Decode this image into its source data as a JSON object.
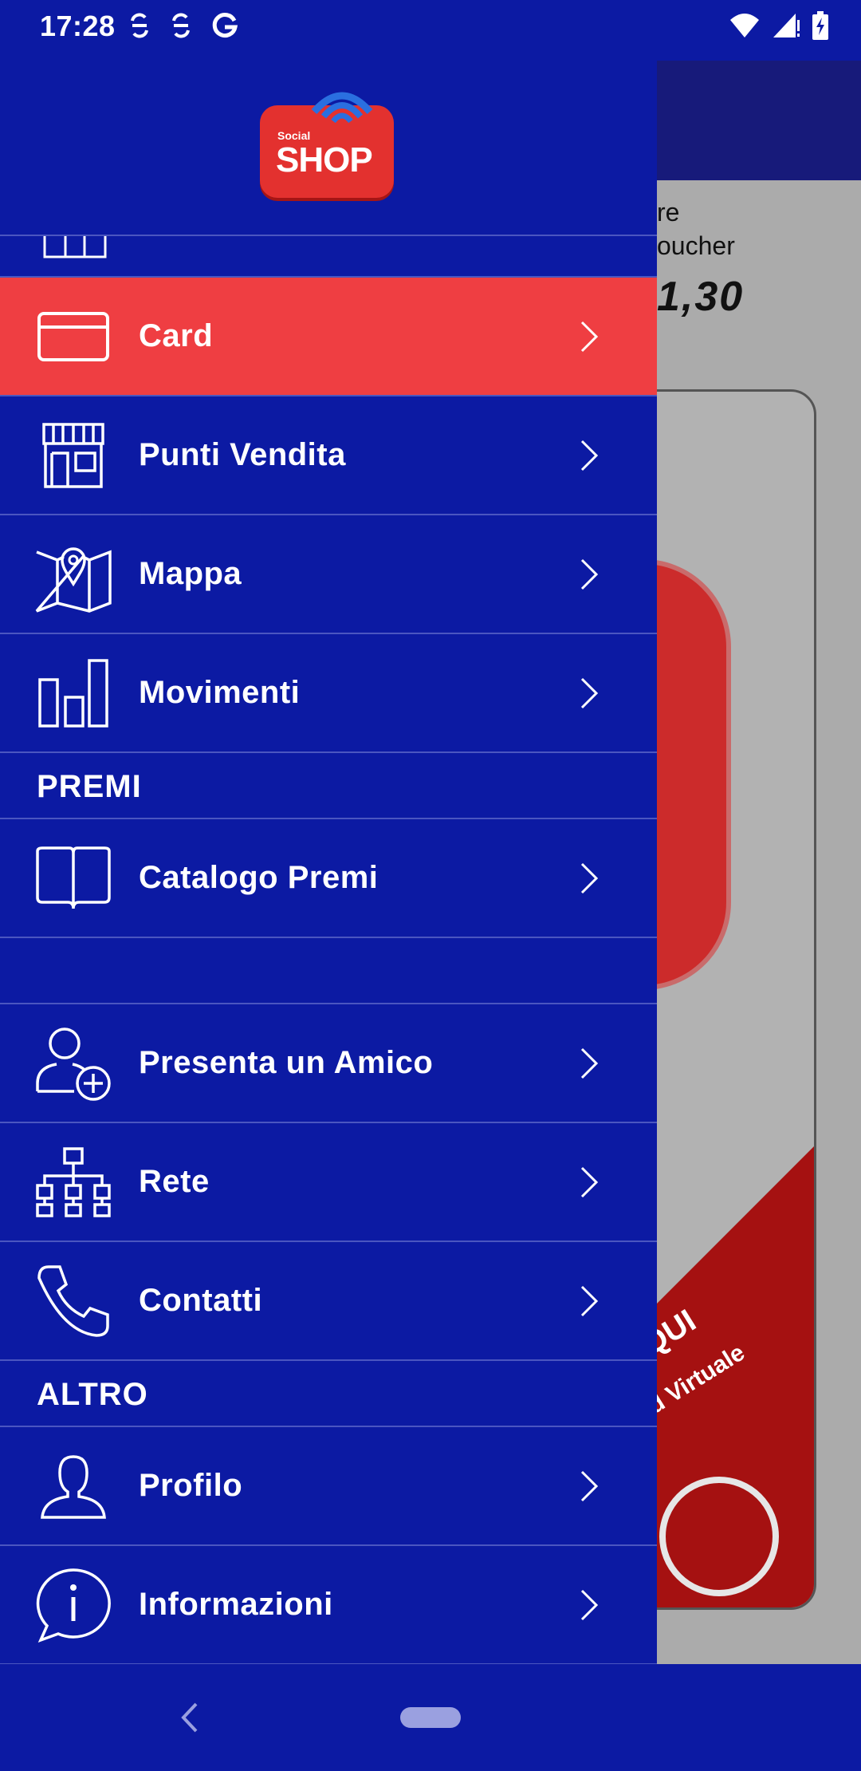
{
  "status_bar": {
    "time": "17:28",
    "left_icons": [
      "sync-icon",
      "sync-icon",
      "google-icon"
    ],
    "right_icons": [
      "wifi-icon",
      "signal-icon",
      "battery-charging-icon"
    ]
  },
  "background_app": {
    "text_line1": "re",
    "text_line2": "oucher",
    "amount": "1,30",
    "band_text1": "QUI",
    "band_text2": "d Virtuale"
  },
  "drawer": {
    "logo": {
      "small": "Social",
      "main": "SHOP",
      "brand_color": "#e3312f"
    },
    "items_before": [
      {
        "id": "card",
        "label": "Card",
        "icon": "credit-card-icon",
        "active": true
      },
      {
        "id": "punti-vendita",
        "label": "Punti Vendita",
        "icon": "store-icon",
        "active": false
      },
      {
        "id": "mappa",
        "label": "Mappa",
        "icon": "map-pin-icon",
        "active": false
      },
      {
        "id": "movimenti",
        "label": "Movimenti",
        "icon": "bar-chart-icon",
        "active": false
      }
    ],
    "section_premi": "PREMI",
    "items_premi": [
      {
        "id": "catalogo-premi",
        "label": "Catalogo Premi",
        "icon": "open-book-icon"
      }
    ],
    "items_middle": [
      {
        "id": "presenta-amico",
        "label": "Presenta un Amico",
        "icon": "add-user-icon"
      },
      {
        "id": "rete",
        "label": "Rete",
        "icon": "network-icon"
      },
      {
        "id": "contatti",
        "label": "Contatti",
        "icon": "phone-icon"
      }
    ],
    "section_altro": "ALTRO",
    "items_altro": [
      {
        "id": "profilo",
        "label": "Profilo",
        "icon": "user-icon"
      },
      {
        "id": "informazioni",
        "label": "Informazioni",
        "icon": "info-bubble-icon"
      }
    ]
  },
  "colors": {
    "primary": "#0c1aa3",
    "active": "#ef3e42",
    "divider": "#4b56c0"
  }
}
